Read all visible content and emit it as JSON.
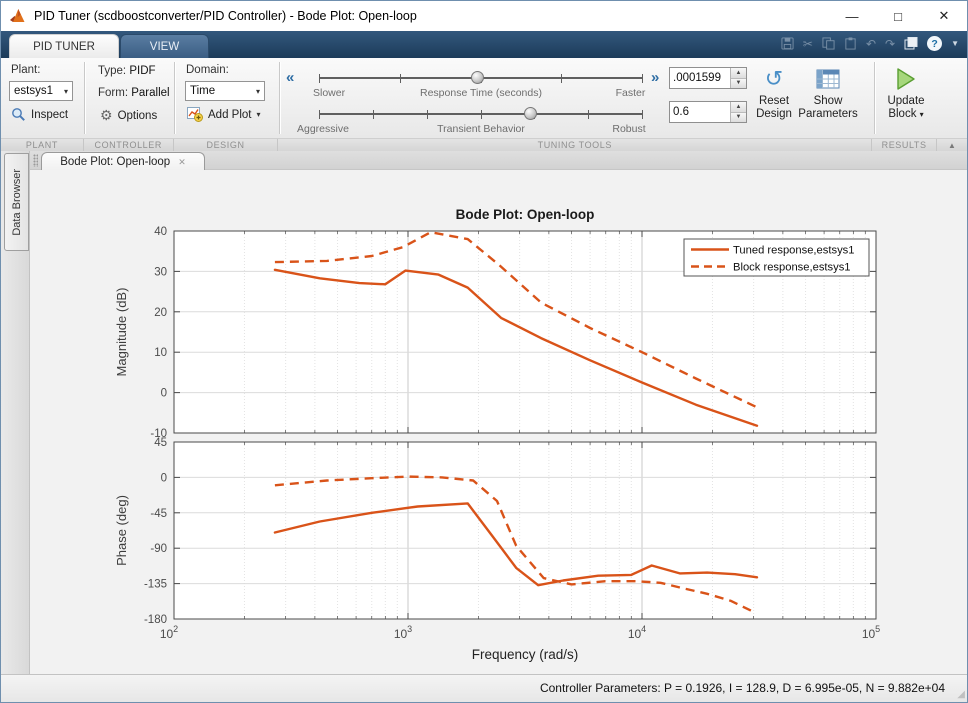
{
  "window": {
    "title": "PID Tuner (scdboostconverter/PID Controller) - Bode Plot: Open-loop"
  },
  "icons": {
    "minimize": "—",
    "maximize": "□",
    "close": "✕",
    "cut": "✂",
    "undo": "↶",
    "redo": "↷",
    "help": "?",
    "qat_caret": "▼",
    "gear": "⚙",
    "chevrons_left": "«",
    "chevrons_right": "»",
    "caret_down": "▾",
    "spin_up": "▲",
    "spin_down": "▼",
    "tab_close": "✕",
    "ribbon_collapse": "▲",
    "resize_grip": "◢",
    "reset_arrow": "↺"
  },
  "tabs": [
    {
      "label": "PID TUNER"
    },
    {
      "label": "VIEW"
    }
  ],
  "ribbon": {
    "plant": {
      "section": "PLANT",
      "label": "Plant:",
      "value": "estsys1",
      "inspect": "Inspect"
    },
    "controller": {
      "section": "CONTROLLER",
      "type_label": "Type:",
      "type_value": "PIDF",
      "form_label": "Form:",
      "form_value": "Parallel",
      "options": "Options"
    },
    "design": {
      "section": "DESIGN",
      "domain_label": "Domain:",
      "domain_value": "Time",
      "add_plot": "Add Plot"
    },
    "tuning": {
      "section": "TUNING TOOLS",
      "slider1": {
        "left": "Slower",
        "center": "Response Time (seconds)",
        "right": "Faster",
        "position": 0.49,
        "ticks": 5
      },
      "slider2": {
        "left": "Aggressive",
        "center": "Transient Behavior",
        "right": "Robust",
        "position": 0.66,
        "ticks": 7
      },
      "value1": ".0001599",
      "value2": "0.6"
    },
    "results": {
      "section": "RESULTS",
      "reset": {
        "line1": "Reset",
        "line2": "Design"
      },
      "show": {
        "line1": "Show",
        "line2": "Parameters"
      },
      "update": {
        "line1": "Update",
        "line2": "Block"
      }
    }
  },
  "data_browser": {
    "label": "Data Browser"
  },
  "doc_tab": {
    "label": "Bode Plot: Open-loop"
  },
  "status_bar": {
    "text": "Controller Parameters: P = 0.1926, I = 128.9, D = 6.995e-05, N = 9.882e+04"
  },
  "chart_data": {
    "type": "line",
    "title": "Bode Plot: Open-loop",
    "xlabel": "Frequency  (rad/s)",
    "x_scale": "log10",
    "x_range": [
      100,
      100000
    ],
    "x_ticks": [
      {
        "base": "10",
        "exp": "2"
      },
      {
        "base": "10",
        "exp": "3"
      },
      {
        "base": "10",
        "exp": "4"
      },
      {
        "base": "10",
        "exp": "5"
      }
    ],
    "grid": true,
    "legend_position": "top-right",
    "legend": [
      "Tuned response,estsys1",
      "Block response,estsys1"
    ],
    "line_color": "#d95319",
    "subplots": [
      {
        "ylabel": "Magnitude (dB)",
        "ylim": [
          -10,
          40
        ],
        "yticks": [
          40,
          30,
          20,
          10,
          0,
          -10
        ],
        "series": [
          {
            "name": "Tuned response,estsys1",
            "style": "solid",
            "x": [
              270,
              420,
              620,
              800,
              975,
              1350,
              1800,
              2500,
              3700,
              6000,
              10000,
              17000,
              31000
            ],
            "y": [
              30.4,
              28.3,
              27.1,
              26.8,
              30.2,
              29.2,
              26.0,
              18.5,
              13.5,
              8.0,
              2.5,
              -3.0,
              -8.2
            ]
          },
          {
            "name": "Block response,estsys1",
            "style": "dashed",
            "x": [
              270,
              450,
              700,
              950,
              1250,
              1800,
              2460,
              3700,
              6000,
              10000,
              17000,
              32000
            ],
            "y": [
              32.3,
              32.6,
              33.8,
              36.0,
              39.7,
              38.0,
              31.5,
              22.3,
              16.0,
              10.0,
              3.5,
              -4.0
            ]
          }
        ]
      },
      {
        "ylabel": "Phase (deg)",
        "ylim": [
          -180,
          45
        ],
        "yticks": [
          45,
          0,
          -45,
          -90,
          -135,
          -180
        ],
        "series": [
          {
            "name": "Tuned response,estsys1",
            "style": "solid",
            "x": [
              270,
              420,
              700,
              1100,
              1800,
              2300,
              2900,
              3600,
              4600,
              6500,
              9000,
              11000,
              14500,
              19000,
              25000,
              31000
            ],
            "y": [
              -70,
              -56,
              -45,
              -37,
              -33,
              -75,
              -115,
              -137,
              -131,
              -125,
              -124,
              -112,
              -122,
              -121,
              -123,
              -127
            ]
          },
          {
            "name": "Block response,estsys1",
            "style": "dashed",
            "x": [
              270,
              450,
              700,
              1000,
              1400,
              1900,
              2400,
              2900,
              3800,
              5000,
              7000,
              9500,
              12000,
              15000,
              19000,
              24000,
              30000
            ],
            "y": [
              -10,
              -4,
              -1,
              1,
              0,
              -4,
              -30,
              -87,
              -128,
              -136,
              -132,
              -132,
              -134,
              -141,
              -148,
              -157,
              -171
            ]
          }
        ]
      }
    ]
  }
}
